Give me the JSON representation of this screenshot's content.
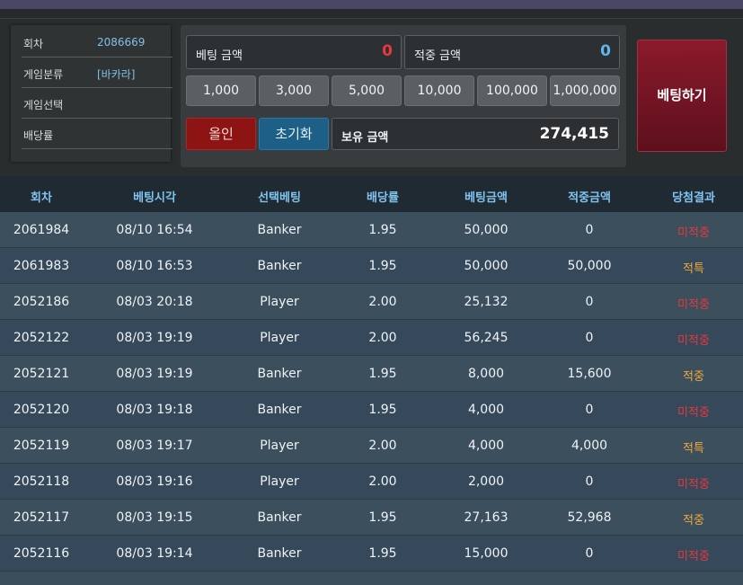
{
  "info": {
    "round_label": "회차",
    "round_value": "2086669",
    "category_label": "게임분류",
    "category_value": "[바카라]",
    "selection_label": "게임선택",
    "selection_value": "",
    "odds_label": "배당률",
    "odds_value": ""
  },
  "bet": {
    "bet_amount_label": "베팅 금액",
    "bet_amount_value": "0",
    "win_amount_label": "적중 금액",
    "win_amount_value": "0",
    "chips": [
      "1,000",
      "3,000",
      "5,000",
      "10,000",
      "100,000",
      "1,000,000"
    ],
    "allin_label": "올인",
    "reset_label": "초기화",
    "balance_label": "보유 금액",
    "balance_value": "274,415",
    "submit_label": "베팅하기"
  },
  "colors": {
    "bet_amount": "#e8383f",
    "win_amount": "#62b3ee",
    "result_miss": "#e8383f",
    "result_hit": "#f0a83a"
  },
  "table": {
    "headers": [
      "회차",
      "베팅시각",
      "선택베팅",
      "배당률",
      "베팅금액",
      "적중금액",
      "당첨결과"
    ],
    "rows": [
      {
        "round": "2061984",
        "time": "08/10 16:54",
        "pick": "Banker",
        "odds": "1.95",
        "bet": "50,000",
        "win": "0",
        "result": "미적중",
        "type": "miss"
      },
      {
        "round": "2061983",
        "time": "08/10 16:53",
        "pick": "Banker",
        "odds": "1.95",
        "bet": "50,000",
        "win": "50,000",
        "result": "적특",
        "type": "hit"
      },
      {
        "round": "2052186",
        "time": "08/03 20:18",
        "pick": "Player",
        "odds": "2.00",
        "bet": "25,132",
        "win": "0",
        "result": "미적중",
        "type": "miss"
      },
      {
        "round": "2052122",
        "time": "08/03 19:19",
        "pick": "Player",
        "odds": "2.00",
        "bet": "56,245",
        "win": "0",
        "result": "미적중",
        "type": "miss"
      },
      {
        "round": "2052121",
        "time": "08/03 19:19",
        "pick": "Banker",
        "odds": "1.95",
        "bet": "8,000",
        "win": "15,600",
        "result": "적중",
        "type": "hit"
      },
      {
        "round": "2052120",
        "time": "08/03 19:18",
        "pick": "Banker",
        "odds": "1.95",
        "bet": "4,000",
        "win": "0",
        "result": "미적중",
        "type": "miss"
      },
      {
        "round": "2052119",
        "time": "08/03 19:17",
        "pick": "Player",
        "odds": "2.00",
        "bet": "4,000",
        "win": "4,000",
        "result": "적특",
        "type": "hit"
      },
      {
        "round": "2052118",
        "time": "08/03 19:16",
        "pick": "Player",
        "odds": "2.00",
        "bet": "2,000",
        "win": "0",
        "result": "미적중",
        "type": "miss"
      },
      {
        "round": "2052117",
        "time": "08/03 19:15",
        "pick": "Banker",
        "odds": "1.95",
        "bet": "27,163",
        "win": "52,968",
        "result": "적중",
        "type": "hit"
      },
      {
        "round": "2052116",
        "time": "08/03 19:14",
        "pick": "Banker",
        "odds": "1.95",
        "bet": "15,000",
        "win": "0",
        "result": "미적중",
        "type": "miss"
      }
    ]
  }
}
